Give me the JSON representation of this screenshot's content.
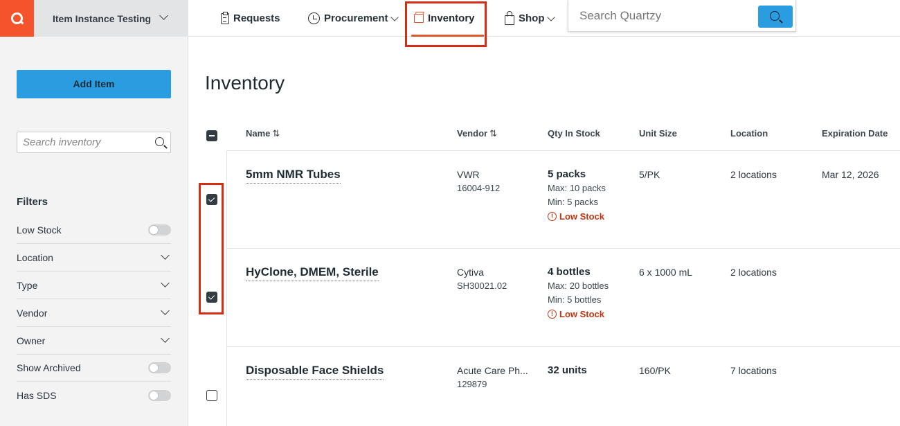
{
  "app": {
    "workspace": "Item Instance Testing"
  },
  "nav": {
    "requests": "Requests",
    "procurement": "Procurement",
    "inventory": "Inventory",
    "shop": "Shop",
    "search_placeholder": "Search Quartzy"
  },
  "sidebar": {
    "add_item_label": "Add Item",
    "search_placeholder": "Search inventory",
    "filters_title": "Filters",
    "filters": [
      {
        "label": "Low Stock",
        "control": "toggle",
        "on": false
      },
      {
        "label": "Location",
        "control": "dropdown"
      },
      {
        "label": "Type",
        "control": "dropdown"
      },
      {
        "label": "Vendor",
        "control": "dropdown"
      },
      {
        "label": "Owner",
        "control": "dropdown"
      },
      {
        "label": "Show Archived",
        "control": "toggle",
        "on": false
      },
      {
        "label": "Has SDS",
        "control": "toggle",
        "on": false
      }
    ]
  },
  "page": {
    "title": "Inventory"
  },
  "table": {
    "headers": {
      "name": "Name",
      "vendor": "Vendor",
      "qty": "Qty In Stock",
      "unit_size": "Unit Size",
      "location": "Location",
      "expiration": "Expiration Date"
    },
    "sort_icon": "⇅",
    "rows": [
      {
        "checked": true,
        "name": "5mm NMR Tubes",
        "vendor": "VWR",
        "catalog": "16004-912",
        "qty": "5 packs",
        "max": "Max: 10 packs",
        "min": "Min: 5 packs",
        "low_stock": "Low Stock",
        "unit_size": "5/PK",
        "location": "2 locations",
        "expiration": "Mar 12, 2026"
      },
      {
        "checked": true,
        "name": "HyClone, DMEM, Sterile",
        "vendor": "Cytiva",
        "catalog": "SH30021.02",
        "qty": "4 bottles",
        "max": "Max: 20 bottles",
        "min": "Min: 5 bottles",
        "low_stock": "Low Stock",
        "unit_size": "6 x 1000 mL",
        "location": "2 locations",
        "expiration": ""
      },
      {
        "checked": false,
        "name": "Disposable Face Shields",
        "vendor": "Acute Care Ph...",
        "catalog": "129879",
        "qty": "32 units",
        "max": "",
        "min": "",
        "low_stock": "",
        "unit_size": "160/PK",
        "location": "7 locations",
        "expiration": ""
      }
    ]
  },
  "colors": {
    "brand": "#f4532b",
    "accent": "#2a9de0",
    "active_tab": "#e2552b",
    "highlight_box": "#d62c14",
    "warning": "#c2340f"
  },
  "icons": {
    "logo": "quartzy-logo-icon",
    "requests": "clipboard-icon",
    "procurement": "dial-icon",
    "inventory": "box-icon",
    "shop": "shopping-bag-icon",
    "search": "search-icon",
    "warning": "warning-circle-icon"
  }
}
